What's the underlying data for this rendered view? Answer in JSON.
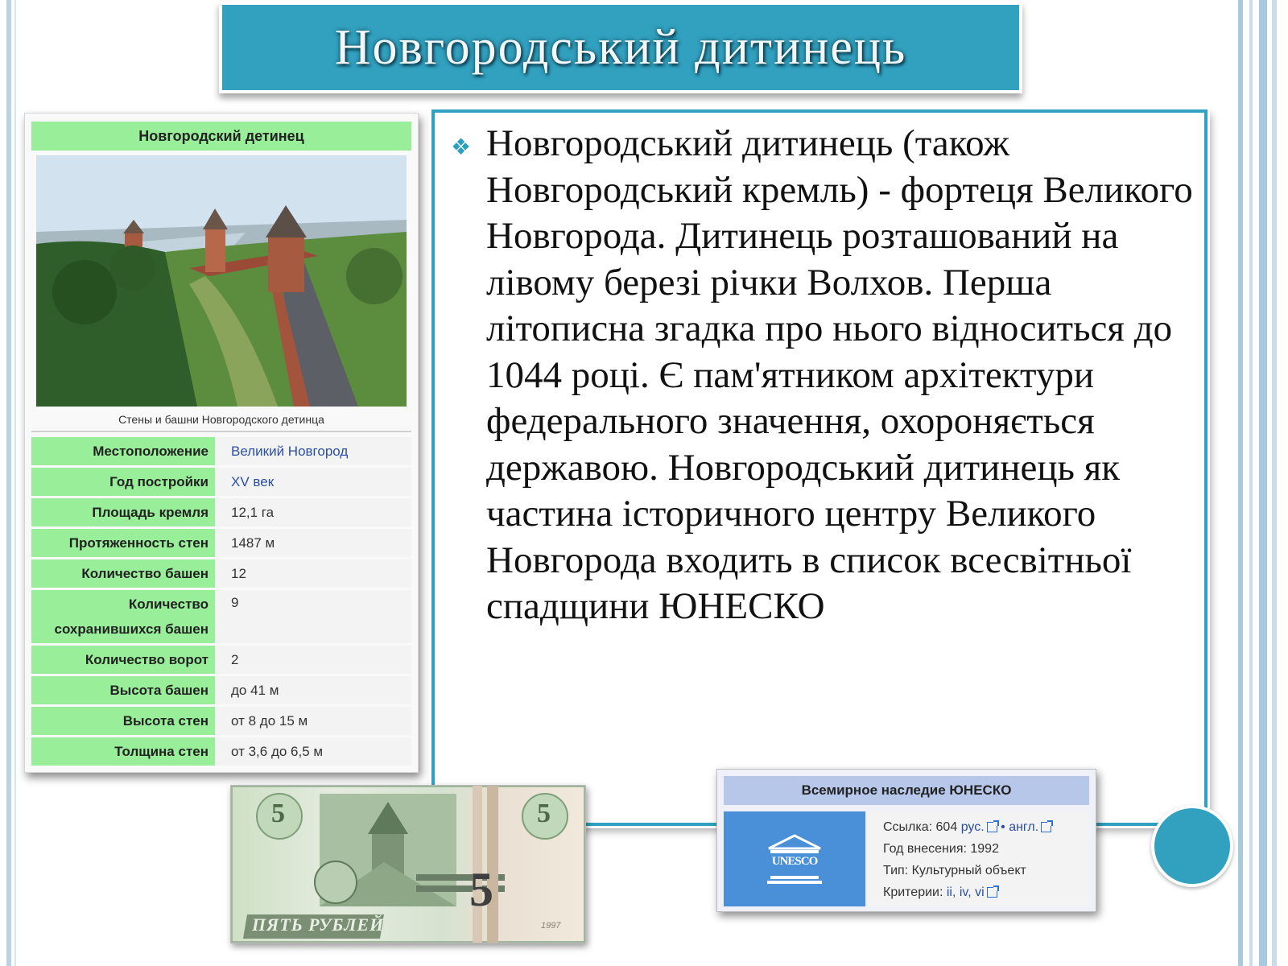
{
  "title": "Новгородський дитинець",
  "main_text": "Новгородський дитинець (також Новгородський кремль) - фортеця Великого Новгорода. Дитинець розташований на лівому березі річки Волхов. Перша літописна згадка про нього відноситься до 1044 році. Є пам'ятником архітектури федерального значення, охороняється державою. Новгородський дитинець як частина історичного центру Великого Новгорода входить в список всесвітньої спадщини ЮНЕСКО",
  "infobox": {
    "heading": "Новгородский детинец",
    "photo_caption": "Стены и башни Новгородского детинца",
    "rows": [
      {
        "key": "Местоположение",
        "value": "Великий Новгород"
      },
      {
        "key": "Год постройки",
        "value": "XV век"
      },
      {
        "key": "Площадь кремля",
        "value": "12,1 га"
      },
      {
        "key": "Протяженность стен",
        "value": "1487 м"
      },
      {
        "key": "Количество башен",
        "value": "12"
      },
      {
        "key": "Количество сохранившихся башен",
        "value": "9"
      },
      {
        "key": "Количество ворот",
        "value": "2"
      },
      {
        "key": "Высота башен",
        "value": "до 41 м"
      },
      {
        "key": "Высота стен",
        "value": "от 8 до 15 м"
      },
      {
        "key": "Толщина стен",
        "value": "от 3,6 до 6,5 м"
      }
    ]
  },
  "banknote": {
    "denomination": "5",
    "text": "ПЯТЬ РУБЛЕЙ",
    "year": "1997"
  },
  "unesco": {
    "heading": "Всемирное наследие ЮНЕСКО",
    "logo_text": "UNESCO",
    "ref_label": "Ссылка: 604",
    "ref_rus": "рус.",
    "ref_sep": "•",
    "ref_eng": "англ.",
    "year": "Год внесения: 1992",
    "type": "Тип: Культурный объект",
    "criteria_label": "Критерии:",
    "criteria": "ii, iv, vi"
  },
  "colors": {
    "accent": "#31a1bf",
    "infobox_green": "#99ee99",
    "unesco_blue": "#4a90d9"
  }
}
